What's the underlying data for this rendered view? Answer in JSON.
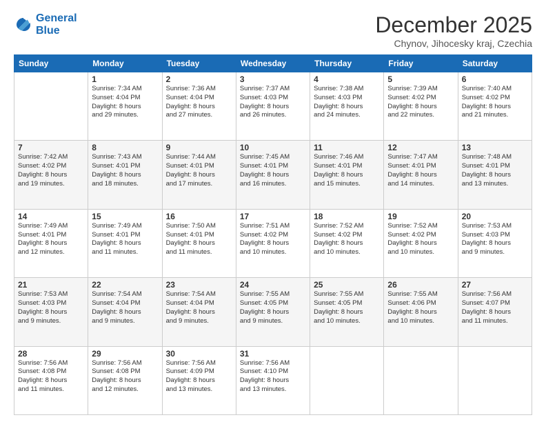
{
  "header": {
    "logo_line1": "General",
    "logo_line2": "Blue",
    "title": "December 2025",
    "subtitle": "Chynov, Jihocesky kraj, Czechia"
  },
  "columns": [
    "Sunday",
    "Monday",
    "Tuesday",
    "Wednesday",
    "Thursday",
    "Friday",
    "Saturday"
  ],
  "weeks": [
    [
      {
        "day": "",
        "info": ""
      },
      {
        "day": "1",
        "info": "Sunrise: 7:34 AM\nSunset: 4:04 PM\nDaylight: 8 hours\nand 29 minutes."
      },
      {
        "day": "2",
        "info": "Sunrise: 7:36 AM\nSunset: 4:04 PM\nDaylight: 8 hours\nand 27 minutes."
      },
      {
        "day": "3",
        "info": "Sunrise: 7:37 AM\nSunset: 4:03 PM\nDaylight: 8 hours\nand 26 minutes."
      },
      {
        "day": "4",
        "info": "Sunrise: 7:38 AM\nSunset: 4:03 PM\nDaylight: 8 hours\nand 24 minutes."
      },
      {
        "day": "5",
        "info": "Sunrise: 7:39 AM\nSunset: 4:02 PM\nDaylight: 8 hours\nand 22 minutes."
      },
      {
        "day": "6",
        "info": "Sunrise: 7:40 AM\nSunset: 4:02 PM\nDaylight: 8 hours\nand 21 minutes."
      }
    ],
    [
      {
        "day": "7",
        "info": "Sunrise: 7:42 AM\nSunset: 4:02 PM\nDaylight: 8 hours\nand 19 minutes."
      },
      {
        "day": "8",
        "info": "Sunrise: 7:43 AM\nSunset: 4:01 PM\nDaylight: 8 hours\nand 18 minutes."
      },
      {
        "day": "9",
        "info": "Sunrise: 7:44 AM\nSunset: 4:01 PM\nDaylight: 8 hours\nand 17 minutes."
      },
      {
        "day": "10",
        "info": "Sunrise: 7:45 AM\nSunset: 4:01 PM\nDaylight: 8 hours\nand 16 minutes."
      },
      {
        "day": "11",
        "info": "Sunrise: 7:46 AM\nSunset: 4:01 PM\nDaylight: 8 hours\nand 15 minutes."
      },
      {
        "day": "12",
        "info": "Sunrise: 7:47 AM\nSunset: 4:01 PM\nDaylight: 8 hours\nand 14 minutes."
      },
      {
        "day": "13",
        "info": "Sunrise: 7:48 AM\nSunset: 4:01 PM\nDaylight: 8 hours\nand 13 minutes."
      }
    ],
    [
      {
        "day": "14",
        "info": "Sunrise: 7:49 AM\nSunset: 4:01 PM\nDaylight: 8 hours\nand 12 minutes."
      },
      {
        "day": "15",
        "info": "Sunrise: 7:49 AM\nSunset: 4:01 PM\nDaylight: 8 hours\nand 11 minutes."
      },
      {
        "day": "16",
        "info": "Sunrise: 7:50 AM\nSunset: 4:01 PM\nDaylight: 8 hours\nand 11 minutes."
      },
      {
        "day": "17",
        "info": "Sunrise: 7:51 AM\nSunset: 4:02 PM\nDaylight: 8 hours\nand 10 minutes."
      },
      {
        "day": "18",
        "info": "Sunrise: 7:52 AM\nSunset: 4:02 PM\nDaylight: 8 hours\nand 10 minutes."
      },
      {
        "day": "19",
        "info": "Sunrise: 7:52 AM\nSunset: 4:02 PM\nDaylight: 8 hours\nand 10 minutes."
      },
      {
        "day": "20",
        "info": "Sunrise: 7:53 AM\nSunset: 4:03 PM\nDaylight: 8 hours\nand 9 minutes."
      }
    ],
    [
      {
        "day": "21",
        "info": "Sunrise: 7:53 AM\nSunset: 4:03 PM\nDaylight: 8 hours\nand 9 minutes."
      },
      {
        "day": "22",
        "info": "Sunrise: 7:54 AM\nSunset: 4:04 PM\nDaylight: 8 hours\nand 9 minutes."
      },
      {
        "day": "23",
        "info": "Sunrise: 7:54 AM\nSunset: 4:04 PM\nDaylight: 8 hours\nand 9 minutes."
      },
      {
        "day": "24",
        "info": "Sunrise: 7:55 AM\nSunset: 4:05 PM\nDaylight: 8 hours\nand 9 minutes."
      },
      {
        "day": "25",
        "info": "Sunrise: 7:55 AM\nSunset: 4:05 PM\nDaylight: 8 hours\nand 10 minutes."
      },
      {
        "day": "26",
        "info": "Sunrise: 7:55 AM\nSunset: 4:06 PM\nDaylight: 8 hours\nand 10 minutes."
      },
      {
        "day": "27",
        "info": "Sunrise: 7:56 AM\nSunset: 4:07 PM\nDaylight: 8 hours\nand 11 minutes."
      }
    ],
    [
      {
        "day": "28",
        "info": "Sunrise: 7:56 AM\nSunset: 4:08 PM\nDaylight: 8 hours\nand 11 minutes."
      },
      {
        "day": "29",
        "info": "Sunrise: 7:56 AM\nSunset: 4:08 PM\nDaylight: 8 hours\nand 12 minutes."
      },
      {
        "day": "30",
        "info": "Sunrise: 7:56 AM\nSunset: 4:09 PM\nDaylight: 8 hours\nand 13 minutes."
      },
      {
        "day": "31",
        "info": "Sunrise: 7:56 AM\nSunset: 4:10 PM\nDaylight: 8 hours\nand 13 minutes."
      },
      {
        "day": "",
        "info": ""
      },
      {
        "day": "",
        "info": ""
      },
      {
        "day": "",
        "info": ""
      }
    ]
  ]
}
